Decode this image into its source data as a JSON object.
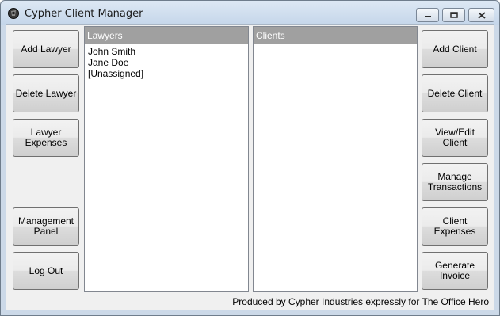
{
  "window": {
    "title": "Cypher Client Manager"
  },
  "left_buttons": [
    {
      "label": "Add Lawyer"
    },
    {
      "label": "Delete Lawyer"
    },
    {
      "label": "Lawyer\nExpenses"
    },
    {
      "label": "Management\nPanel"
    },
    {
      "label": "Log Out"
    }
  ],
  "lawyers_panel": {
    "header": "Lawyers",
    "items": [
      "John Smith",
      "Jane Doe",
      "[Unassigned]"
    ]
  },
  "clients_panel": {
    "header": "Clients",
    "items": []
  },
  "right_buttons": [
    {
      "label": "Add Client"
    },
    {
      "label": "Delete Client"
    },
    {
      "label": "View/Edit\nClient"
    },
    {
      "label": "Manage\nTransactions"
    },
    {
      "label": "Client\nExpenses"
    },
    {
      "label": "Generate\nInvoice"
    }
  ],
  "footer": {
    "text": "Produced by Cypher Industries expressly for The Office Hero"
  }
}
